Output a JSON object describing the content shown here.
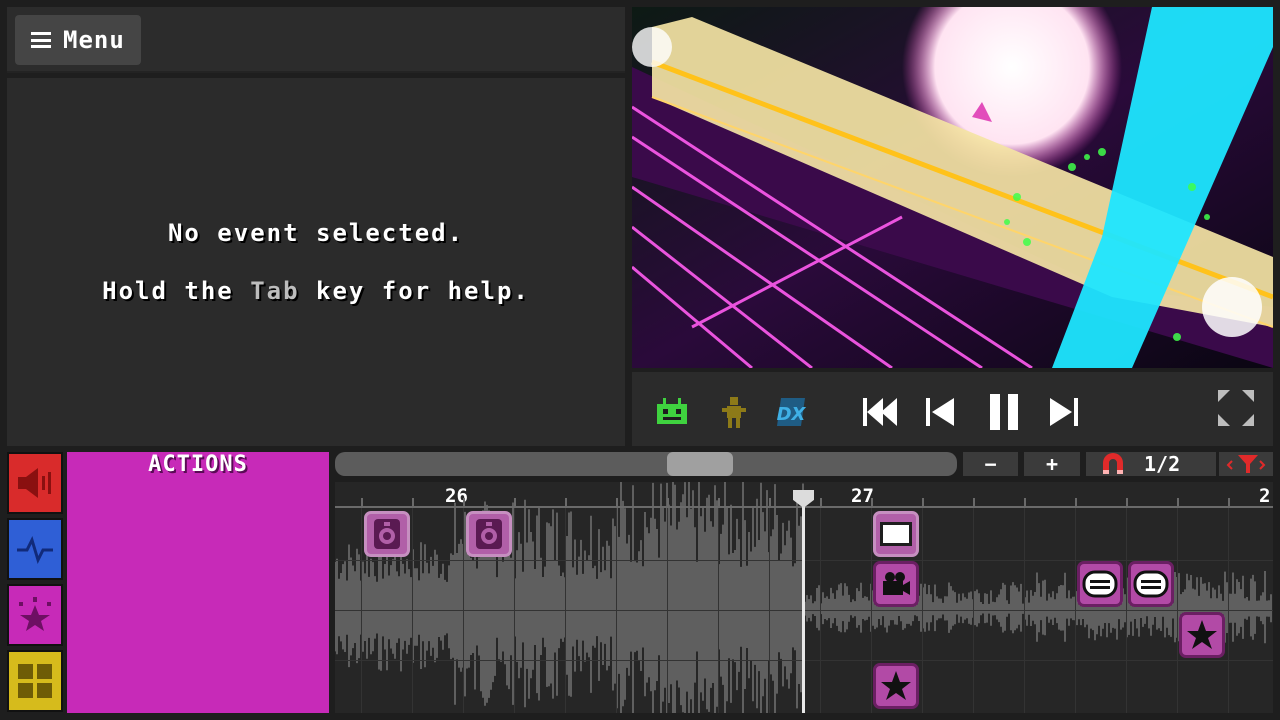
{
  "menu": {
    "label": "Menu"
  },
  "info": {
    "line1": "No event selected.",
    "line2_pre": "Hold the ",
    "line2_key": "Tab",
    "line2_post": " key for help."
  },
  "sidebar": {
    "categories": [
      {
        "name": "sound",
        "color": "#d92b2b"
      },
      {
        "name": "rails",
        "color": "#2f5fd6"
      },
      {
        "name": "actions",
        "color": "#c72ab8"
      },
      {
        "name": "rooms",
        "color": "#d6bb1c"
      }
    ]
  },
  "actions_panel": {
    "title": "ACTIONS"
  },
  "timeline": {
    "zoom_out": "−",
    "zoom_in": "+",
    "subdivision": "1/2",
    "beats": [
      "26",
      "27",
      "2"
    ]
  },
  "colors": {
    "actions": "#c72ab8",
    "event_fill": "#b24aa6"
  }
}
